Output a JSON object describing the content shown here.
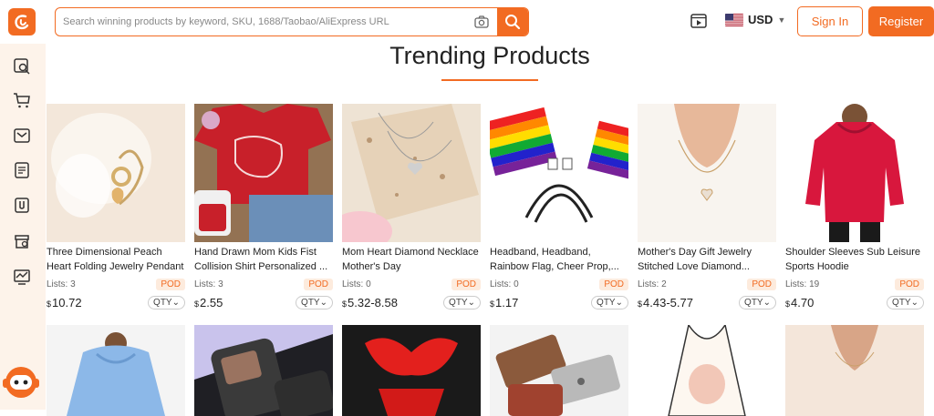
{
  "header": {
    "search_placeholder": "Search winning products by keyword, SKU, 1688/Taobao/AliExpress URL",
    "currency": "USD",
    "signin_label": "Sign In",
    "register_label": "Register"
  },
  "main": {
    "title": "Trending Products"
  },
  "products": [
    {
      "name": "Three Dimensional Peach Heart Folding Jewelry Pendant",
      "lists": "Lists: 3",
      "badge": "POD",
      "currency": "$",
      "price": "10.72",
      "qty": "QTY"
    },
    {
      "name": "Hand Drawn Mom Kids Fist Collision Shirt Personalized ...",
      "lists": "Lists: 3",
      "badge": "POD",
      "currency": "$",
      "price": "2.55",
      "qty": "QTY"
    },
    {
      "name": "Mom Heart Diamond Necklace Mother's Day",
      "lists": "Lists: 0",
      "badge": "POD",
      "currency": "$",
      "price": "5.32-8.58",
      "qty": "QTY"
    },
    {
      "name": "Headband, Headband, Rainbow Flag, Cheer Prop,...",
      "lists": "Lists: 0",
      "badge": "POD",
      "currency": "$",
      "price": "1.17",
      "qty": "QTY"
    },
    {
      "name": "Mother's Day Gift Jewelry Stitched Love Diamond...",
      "lists": "Lists: 2",
      "badge": "POD",
      "currency": "$",
      "price": "4.43-5.77",
      "qty": "QTY"
    },
    {
      "name": "Shoulder Sleeves Sub Leisure Sports Hoodie",
      "lists": "Lists: 19",
      "badge": "POD",
      "currency": "$",
      "price": "4.70",
      "qty": "QTY"
    }
  ]
}
